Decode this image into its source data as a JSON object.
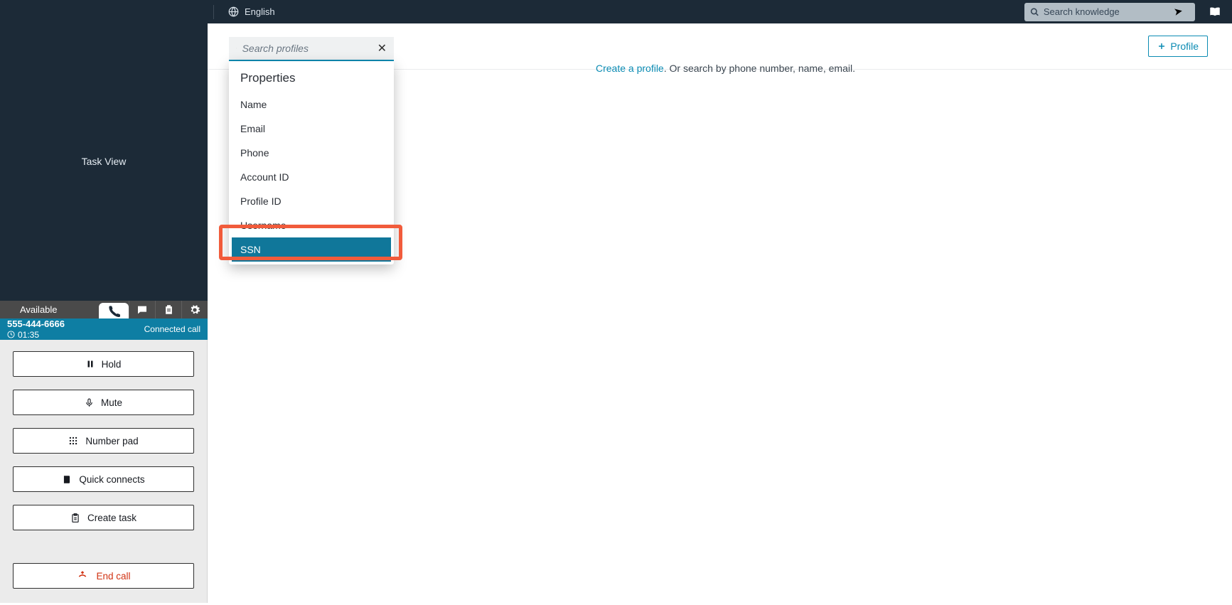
{
  "topbar": {
    "language": "English",
    "search_placeholder": "Search knowledge"
  },
  "sidebar": {
    "task_view": "Task View",
    "status": "Available",
    "call": {
      "number": "555-444-6666",
      "timer": "01:35",
      "status": "Connected call"
    },
    "controls": {
      "hold": "Hold",
      "mute": "Mute",
      "numpad": "Number pad",
      "quick": "Quick connects",
      "task": "Create task",
      "end": "End call"
    }
  },
  "main": {
    "profile_btn": "Profile",
    "search_placeholder": "Search profiles",
    "helper_link": "Create a profile",
    "helper_suffix": ". Or search by phone number, name, email.",
    "dropdown": {
      "heading": "Properties",
      "items": [
        "Name",
        "Email",
        "Phone",
        "Account ID",
        "Profile ID",
        "Username",
        "SSN"
      ],
      "selected_index": 6
    }
  }
}
